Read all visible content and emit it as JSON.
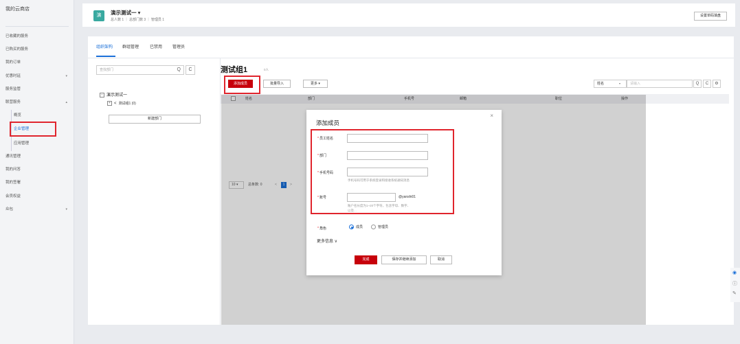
{
  "sidebar": {
    "title": "我的云商店",
    "items": [
      {
        "label": "已收藏的服务",
        "arrow": ""
      },
      {
        "label": "已购买的服务",
        "arrow": ""
      },
      {
        "label": "我的订单",
        "arrow": ""
      },
      {
        "label": "优惠时延",
        "arrow": "▾"
      },
      {
        "label": "服务监管",
        "arrow": ""
      },
      {
        "label": "联营服务",
        "arrow": "▴"
      }
    ],
    "subitems": [
      {
        "label": "概览"
      },
      {
        "label": "企业管理"
      },
      {
        "label": "应用管理"
      }
    ],
    "items2": [
      {
        "label": "通讯管理",
        "arrow": ""
      },
      {
        "label": "我的问答",
        "arrow": ""
      },
      {
        "label": "我的签署",
        "arrow": ""
      },
      {
        "label": "会员权益",
        "arrow": ""
      },
      {
        "label": "众包",
        "arrow": "▾"
      }
    ]
  },
  "header": {
    "avatar": "演",
    "org_name": "演示测试一 ▾",
    "org_meta": "总人数 1 ｜ 总部门数 3 ｜ 管理员 1",
    "contact_button": "设置单码填盘"
  },
  "tabs": [
    {
      "label": "组织架构"
    },
    {
      "label": "群组管理"
    },
    {
      "label": "已禁用"
    },
    {
      "label": "管理员"
    }
  ],
  "tree": {
    "search_placeholder": "查找部门",
    "search_icon": "Q",
    "refresh_icon": "C",
    "root_toggle": "−",
    "root_label": "演示测试一",
    "child_toggle": "+",
    "child_label": "测试组1 (0)",
    "child_icon": "share-icon",
    "new_dept_button": "新建部门"
  },
  "content": {
    "group_title": "测试组1",
    "group_count": "0人",
    "add_button": "添加成员",
    "import_button": "批量导入",
    "more_button": "更多 ▾",
    "filter_field": "姓名",
    "filter_caret": "▾",
    "filter_placeholder": "请输入",
    "search_icon": "Q",
    "refresh_icon": "C",
    "settings_icon": "⚙",
    "columns": [
      "姓名",
      "部门",
      "手机号",
      "邮箱",
      "职位",
      "操作"
    ],
    "pager": {
      "size": "10 ▾",
      "total": "总条数: 0",
      "prev": "<",
      "page": "1",
      "next": ">"
    }
  },
  "modal": {
    "title": "添加成员",
    "close": "×",
    "fields": {
      "name_label": "员工姓名",
      "dept_label": "部门",
      "phone_label": "手机号码",
      "phone_hint": "手机号码可用于系统登录和接收系统通知消息",
      "account_label": "账号",
      "account_suffix": "@yanshi01",
      "account_hint_1": "账户名长度为1~20个字符，包含字母、数字、",
      "account_hint_2": "以及..."
    },
    "required_mark": "*",
    "role_label": "角色",
    "role_options": [
      "成员",
      "管理员"
    ],
    "more_info": "更多信息 ∨",
    "done_button": "完成",
    "save_next_button": "保存并继续添加",
    "cancel_button": "取消"
  },
  "float_tools": {
    "help": "◉",
    "info": "ⓘ",
    "edit": "✎"
  },
  "colors": {
    "brand_red": "#c7000b",
    "accent_blue": "#1a6fd8",
    "highlight": "#e0242c",
    "avatar_teal": "#39a9a0"
  }
}
